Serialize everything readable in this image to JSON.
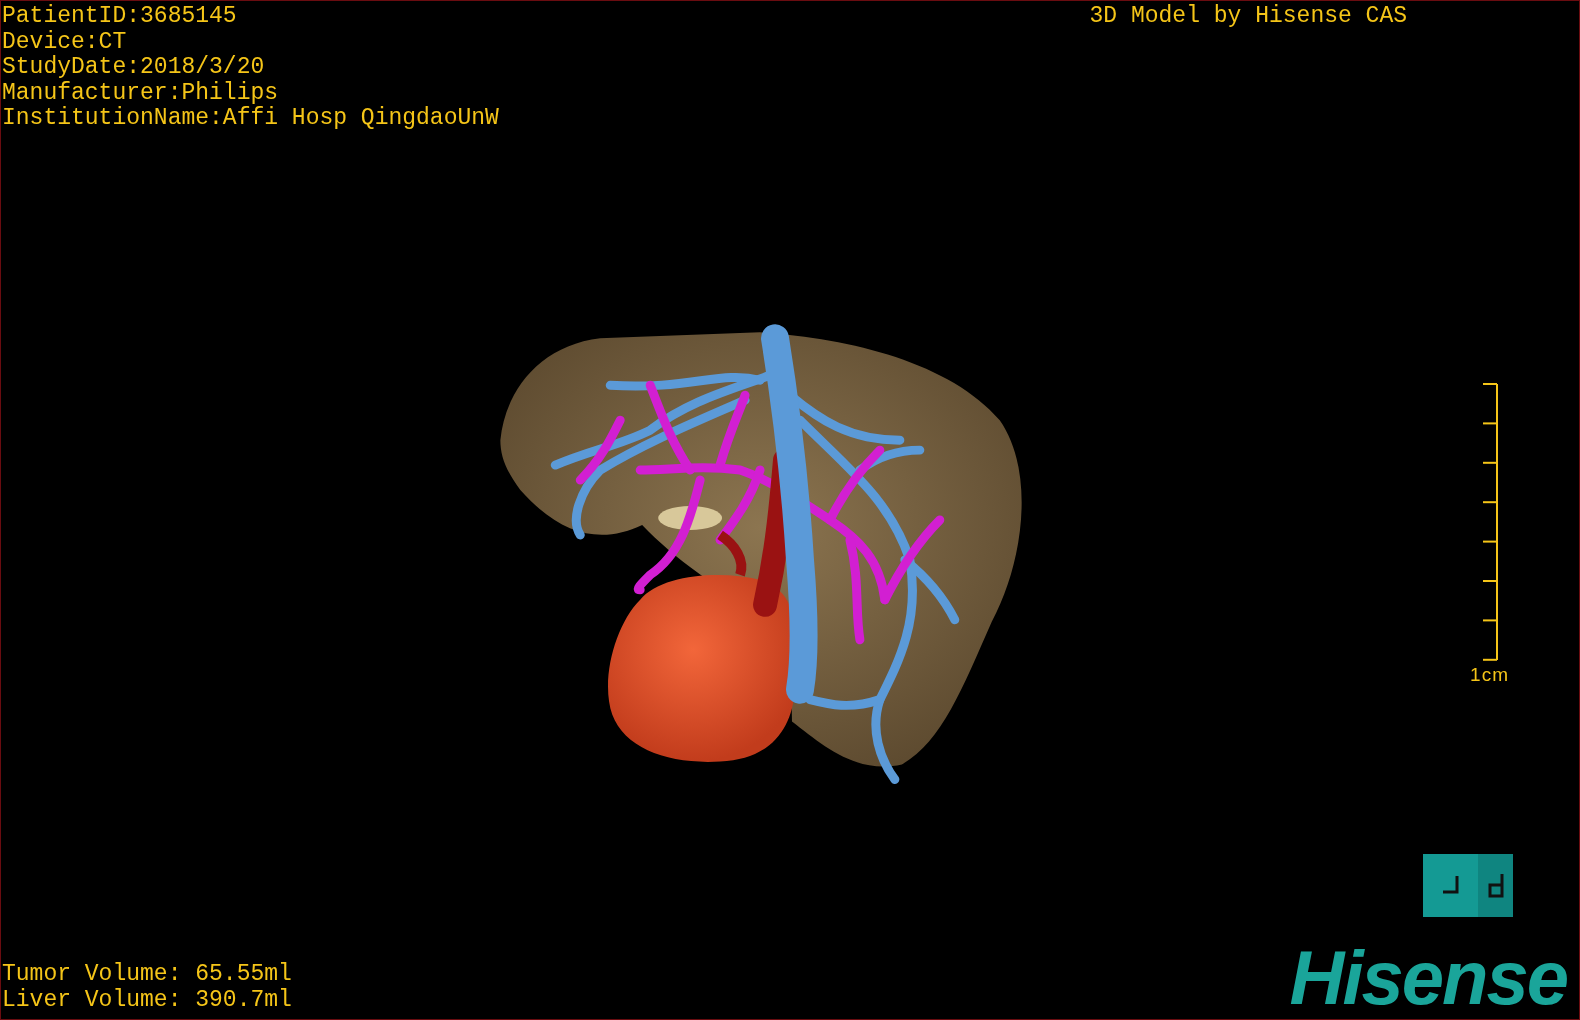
{
  "patient_info": [
    "PatientID:3685145",
    "Device:CT",
    "StudyDate:2018/3/20",
    "Manufacturer:Philips",
    "InstitutionName:Affi Hosp QingdaoUnW"
  ],
  "title": "3D Model by Hisense CAS",
  "scale_bar": {
    "label": "1cm"
  },
  "volumes": [
    "Tumor Volume: 65.55ml",
    "Liver Volume: 390.7ml"
  ],
  "logo": {
    "text": "Hisense"
  }
}
